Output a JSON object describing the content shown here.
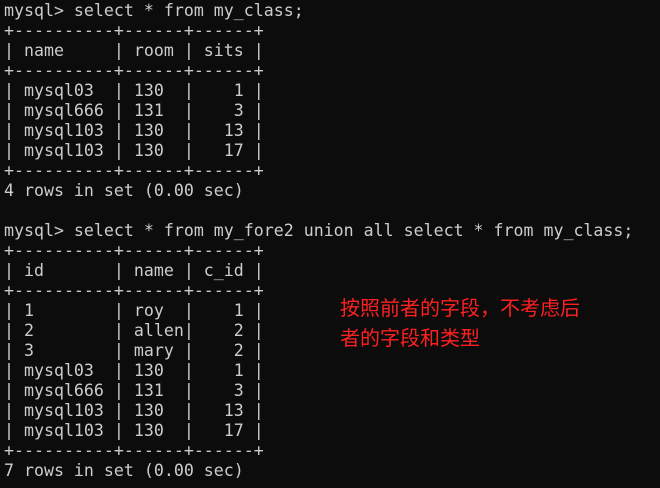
{
  "terminal": {
    "fg_color": "#cccccc",
    "bg_color": "#0c0c0c",
    "lines": [
      "mysql> select * from my_class;",
      "+----------+------+------+",
      "| name     | room | sits |",
      "+----------+------+------+",
      "| mysql03  | 130  |    1 |",
      "| mysql666 | 131  |    3 |",
      "| mysql103 | 130  |   13 |",
      "| mysql103 | 130  |   17 |",
      "+----------+------+------+",
      "4 rows in set (0.00 sec)",
      "",
      "mysql> select * from my_fore2 union all select * from my_class;",
      "+----------+------+------+",
      "| id       | name | c_id |",
      "+----------+------+------+",
      "| 1        | roy  |    1 |",
      "| 2        | allen|    2 |",
      "| 3        | mary |    2 |",
      "| mysql03  | 130  |    1 |",
      "| mysql666 | 131  |    3 |",
      "| mysql103 | 130  |   13 |",
      "| mysql103 | 130  |   17 |",
      "+----------+------+------+",
      "7 rows in set (0.00 sec)"
    ]
  },
  "annotation": {
    "color": "#ff2020",
    "lines": [
      "按照前者的字段，不考虑后",
      "者的字段和类型"
    ]
  }
}
